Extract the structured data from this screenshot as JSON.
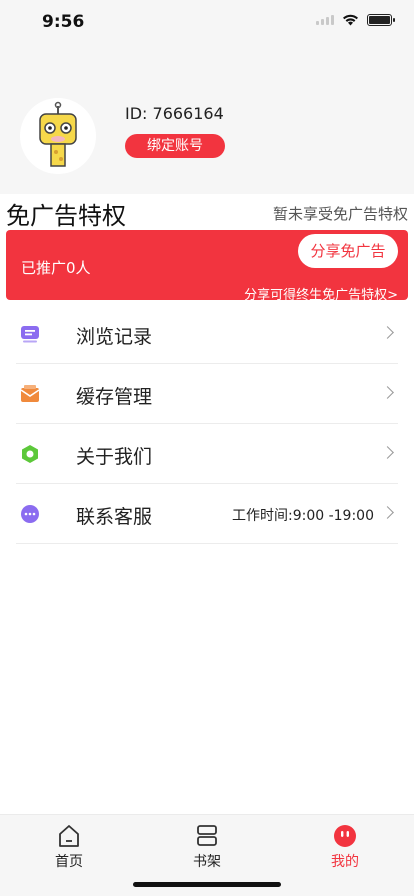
{
  "status_bar": {
    "time": "9:56"
  },
  "profile": {
    "id_text": "ID: 7666164",
    "bind_button": "绑定账号"
  },
  "ad_free": {
    "title": "免广告特权",
    "status": "暂未享受免广告特权",
    "promoted_count": "已推广0人",
    "share_button": "分享免广告",
    "note": "分享可得终生免广告特权>"
  },
  "menu": [
    {
      "label": "浏览记录",
      "icon": "history-icon",
      "color": "#8b6cf0"
    },
    {
      "label": "缓存管理",
      "icon": "cache-icon",
      "color": "#f08a3c"
    },
    {
      "label": "关于我们",
      "icon": "about-icon",
      "color": "#5cc83a"
    },
    {
      "label": "联系客服",
      "icon": "customer-service-icon",
      "color": "#8b6cf0",
      "extra": "工作时间:9:00 -19:00"
    }
  ],
  "tabs": [
    {
      "label": "首页",
      "icon": "home-icon"
    },
    {
      "label": "书架",
      "icon": "bookshelf-icon"
    },
    {
      "label": "我的",
      "icon": "profile-icon",
      "active": true
    }
  ],
  "colors": {
    "accent": "#f2343f",
    "background": "#f6f6f6"
  }
}
